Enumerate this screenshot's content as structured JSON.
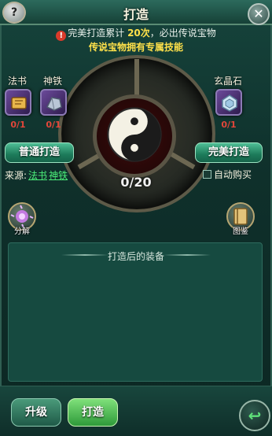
{
  "header": {
    "title": "打造",
    "help_label": "?",
    "close_label": "✕"
  },
  "notice": {
    "warn_icon": "!",
    "part1": "完美打造累计",
    "count": "20次",
    "part2": "，必出传说宝物",
    "line2": "传说宝物拥有专属技能"
  },
  "materials": [
    {
      "label": "法书",
      "count": "0/1",
      "icon": "scroll-icon"
    },
    {
      "label": "神铁",
      "count": "0/1",
      "icon": "iron-ore-icon"
    },
    {
      "label": "玄晶石",
      "count": "0/1",
      "icon": "crystal-icon"
    }
  ],
  "progress": {
    "text": "0/20",
    "value": 0,
    "max": 20
  },
  "buttons": {
    "normal_forge": "普通打造",
    "perfect_forge": "完美打造",
    "decompose": "分解",
    "catalog": "图鉴"
  },
  "source": {
    "label": "来源:",
    "link1": "法书",
    "link2": "神铁"
  },
  "auto_buy": {
    "label": "自动购买",
    "checked": false
  },
  "result": {
    "title": "打造后的装备"
  },
  "tabs": {
    "upgrade": "升级",
    "forge": "打造"
  },
  "back": {
    "icon": "↩"
  },
  "colors": {
    "accent_green": "#4cf07a",
    "warning_yellow": "#ffe14a",
    "count_red": "#e2463a"
  }
}
